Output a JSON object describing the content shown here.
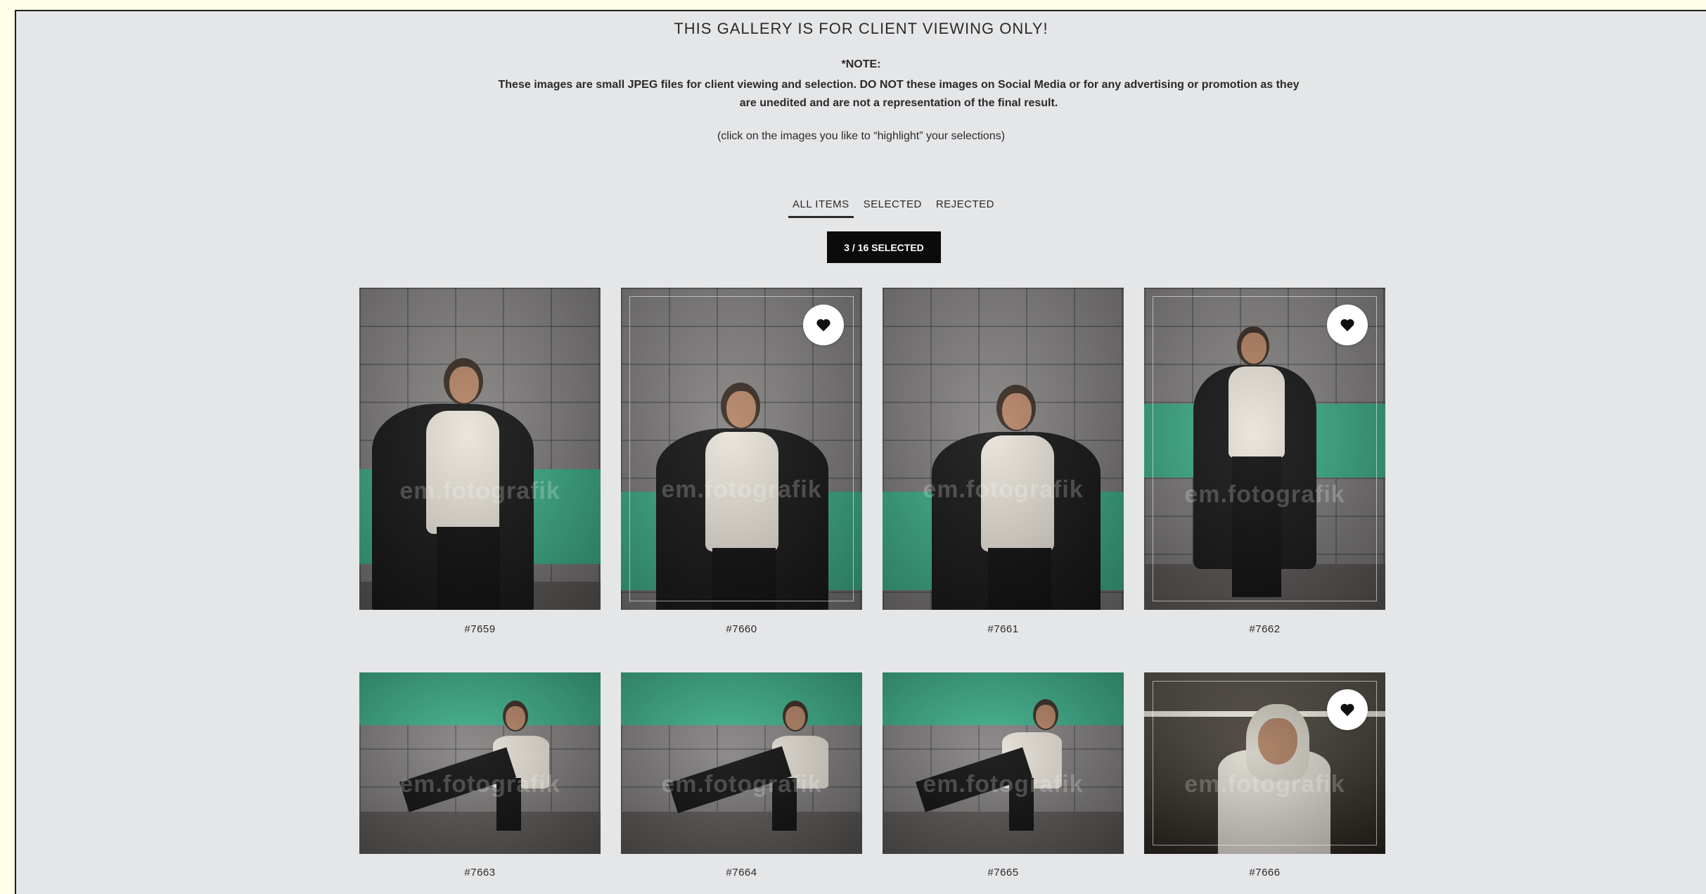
{
  "notice": {
    "heading": "THIS GALLERY IS FOR CLIENT VIEWING ONLY!",
    "note_title": "*NOTE:",
    "note_body": "These images are small JPEG files for client viewing and selection. DO NOT these images on Social Media or for any advertising or promotion as they are unedited and are not a representation of the final result.",
    "hint": "(click on the images you like to “highlight” your selections)"
  },
  "tabs": [
    "ALL ITEMS",
    "SELECTED",
    "REJECTED"
  ],
  "active_tab": "ALL ITEMS",
  "selection_counter": "3 / 16 SELECTED",
  "watermark": "em.fotografik",
  "photos": [
    {
      "label": "#7659",
      "selected": false
    },
    {
      "label": "#7660",
      "selected": true
    },
    {
      "label": "#7661",
      "selected": false
    },
    {
      "label": "#7662",
      "selected": true
    },
    {
      "label": "#7663",
      "selected": false
    },
    {
      "label": "#7664",
      "selected": false
    },
    {
      "label": "#7665",
      "selected": false
    },
    {
      "label": "#7666",
      "selected": true
    }
  ],
  "colors": {
    "page_bg": "#e5e6e8",
    "accent_stripe": "#3fb38c",
    "counter_bg": "#0b0b0b"
  }
}
